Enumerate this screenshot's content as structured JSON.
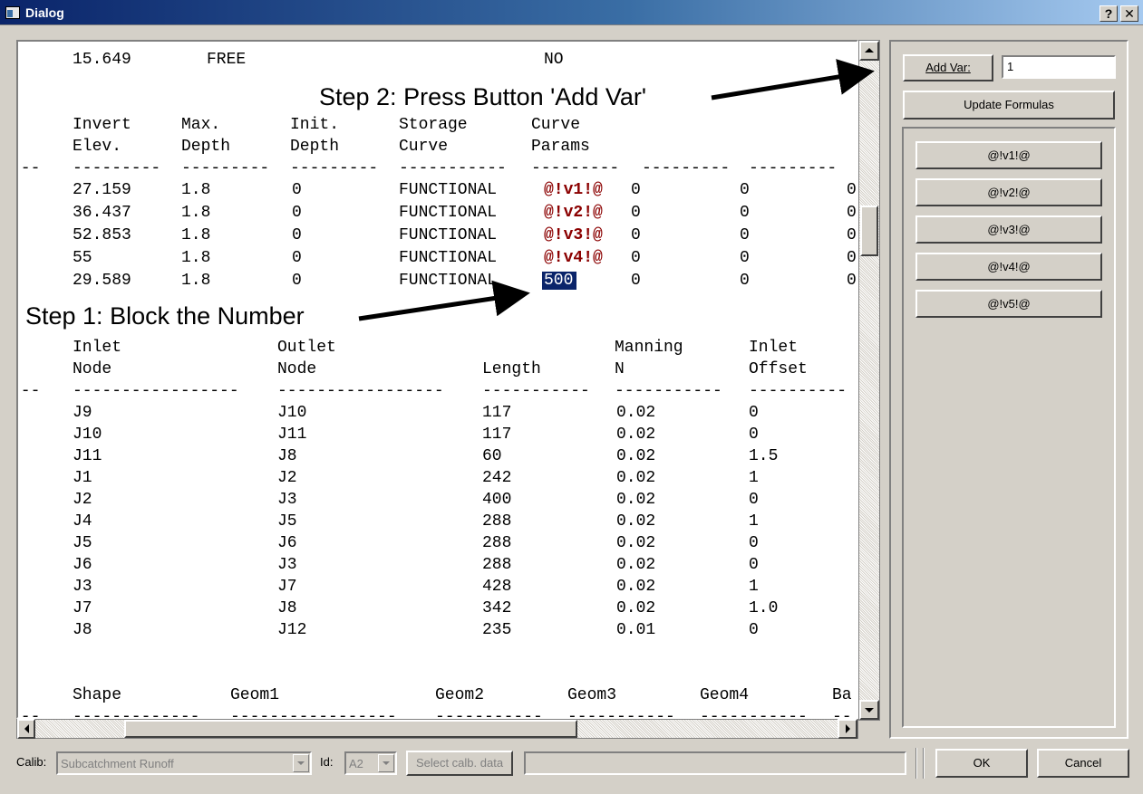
{
  "window": {
    "title": "Dialog",
    "help_label": "?",
    "close_label": "✕"
  },
  "report": {
    "row_free": [
      "15.649",
      "FREE",
      "NO"
    ],
    "storage_header1": [
      "Invert",
      "Max.",
      "Init.",
      "Storage",
      "Curve"
    ],
    "storage_header2": [
      "Elev.",
      "Depth",
      "Depth",
      "Curve",
      "Params"
    ],
    "storage_rows": [
      [
        "27.159",
        "1.8",
        "0",
        "FUNCTIONAL",
        "@!v1!@",
        "0",
        "0",
        "0"
      ],
      [
        "36.437",
        "1.8",
        "0",
        "FUNCTIONAL",
        "@!v2!@",
        "0",
        "0",
        "0"
      ],
      [
        "52.853",
        "1.8",
        "0",
        "FUNCTIONAL",
        "@!v3!@",
        "0",
        "0",
        "0"
      ],
      [
        "55",
        "1.8",
        "0",
        "FUNCTIONAL",
        "@!v4!@",
        "0",
        "0",
        "0"
      ],
      [
        "29.589",
        "1.8",
        "0",
        "FUNCTIONAL",
        "500",
        "0",
        "0",
        "0"
      ]
    ],
    "conduit_header1": [
      "Inlet",
      "Outlet",
      "Manning",
      "Inlet"
    ],
    "conduit_header2": [
      "Node",
      "Node",
      "Length",
      "N",
      "Offset"
    ],
    "conduit_rows": [
      [
        "J9",
        "J10",
        "117",
        "0.02",
        "0"
      ],
      [
        "J10",
        "J11",
        "117",
        "0.02",
        "0"
      ],
      [
        "J11",
        "J8",
        "60",
        "0.02",
        "1.5"
      ],
      [
        "J1",
        "J2",
        "242",
        "0.02",
        "1"
      ],
      [
        "J2",
        "J3",
        "400",
        "0.02",
        "0"
      ],
      [
        "J4",
        "J5",
        "288",
        "0.02",
        "1"
      ],
      [
        "J5",
        "J6",
        "288",
        "0.02",
        "0"
      ],
      [
        "J6",
        "J3",
        "288",
        "0.02",
        "0"
      ],
      [
        "J3",
        "J7",
        "428",
        "0.02",
        "1"
      ],
      [
        "J7",
        "J8",
        "342",
        "0.02",
        "1.0"
      ],
      [
        "J8",
        "J12",
        "235",
        "0.01",
        "0"
      ]
    ],
    "xsection_header": [
      "Shape",
      "Geom1",
      "Geom2",
      "Geom3",
      "Geom4",
      "Ba"
    ]
  },
  "annotations": {
    "step1": "Step 1: Block the Number",
    "step2": "Step 2: Press Button 'Add Var'"
  },
  "sidepanel": {
    "add_var_label": "Add Var:",
    "add_var_value": "1",
    "update_formulas_label": "Update Formulas",
    "var_buttons": [
      "@!v1!@",
      "@!v2!@",
      "@!v3!@",
      "@!v4!@",
      "@!v5!@"
    ]
  },
  "bottom": {
    "calib_label": "Calib:",
    "calib_value": "Subcatchment Runoff",
    "id_label": "Id:",
    "id_value": "A2",
    "select_calib_label": "Select calb. data",
    "ok_label": "OK",
    "cancel_label": "Cancel"
  }
}
